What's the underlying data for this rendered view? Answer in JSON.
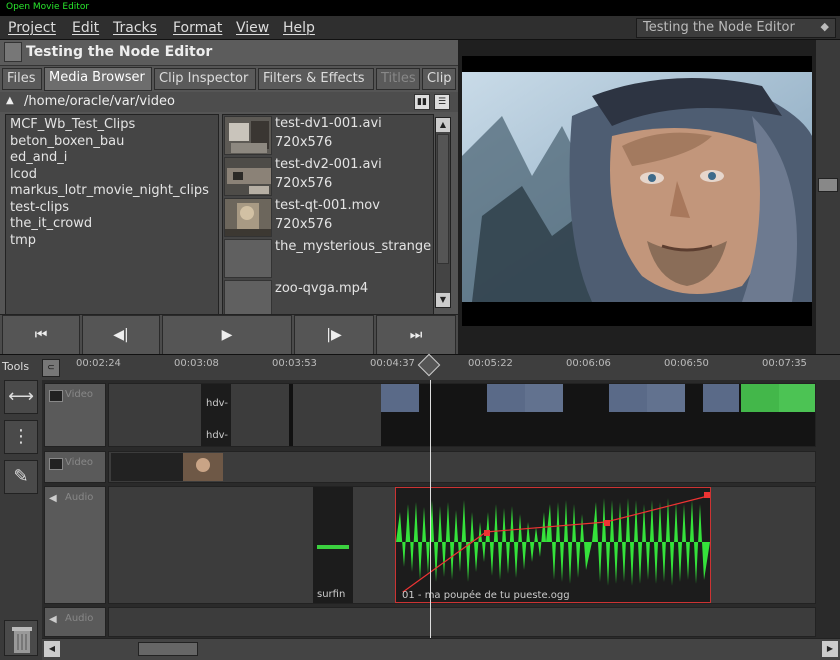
{
  "window": {
    "title": "Open Movie Editor"
  },
  "menu": [
    {
      "label": "Project"
    },
    {
      "label": "Edit"
    },
    {
      "label": "Tracks"
    },
    {
      "label": "Format"
    },
    {
      "label": "View"
    },
    {
      "label": "Help"
    }
  ],
  "project_select": {
    "value": "Testing the Node Editor"
  },
  "panel": {
    "title": "Testing the Node Editor"
  },
  "tabs": [
    {
      "label": "Files"
    },
    {
      "label": "Media Browser"
    },
    {
      "label": "Clip Inspector"
    },
    {
      "label": "Filters & Effects"
    },
    {
      "label": "Titles"
    },
    {
      "label": "Clip"
    }
  ],
  "browser": {
    "path": "/home/oracle/var/video",
    "folders": [
      "MCF_Wb_Test_Clips",
      "beton_boxen_bau",
      "ed_and_i",
      "lcod",
      "markus_lotr_movie_night_clips",
      "test-clips",
      "the_it_crowd",
      "tmp"
    ],
    "files": [
      {
        "name": "test-dv1-001.avi",
        "size": "720x576"
      },
      {
        "name": "test-dv2-001.avi",
        "size": "720x576"
      },
      {
        "name": "test-qt-001.mov",
        "size": "720x576"
      },
      {
        "name": "the_mysterious_strange",
        "size": ""
      },
      {
        "name": "zoo-qvga.mp4",
        "size": ""
      }
    ]
  },
  "transport": {
    "first": "⏮",
    "prev": "◀|",
    "play": "▶",
    "next": "|▶",
    "last": "⏭"
  },
  "timeline": {
    "tools_label": "Tools",
    "ticks": [
      "00:02:24",
      "00:03:08",
      "00:03:53",
      "00:04:37",
      "00:05:22",
      "00:06:06",
      "00:06:50",
      "00:07:35"
    ],
    "tracks": [
      {
        "label": "Video"
      },
      {
        "label": "Video"
      },
      {
        "label": "Audio"
      },
      {
        "label": "Audio"
      }
    ],
    "clips": {
      "hdv_top": "hdv-",
      "hdv_bottom": "hdv-",
      "audio_small": "surfin",
      "audio_main": "01 - ma poupée de tu pueste.ogg"
    }
  }
}
